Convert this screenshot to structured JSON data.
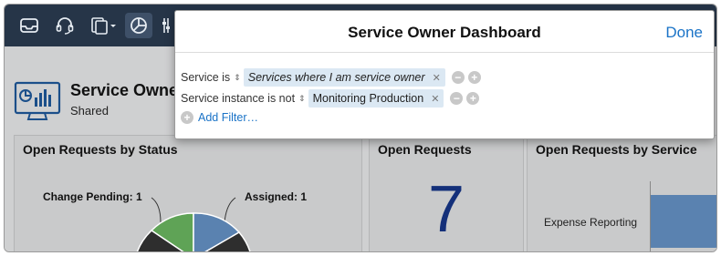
{
  "topbar": {
    "icons": [
      "inbox-icon",
      "headset-icon",
      "documents-icon",
      "dashboard-icon",
      "settings-icon"
    ]
  },
  "dashboard": {
    "title": "Service Owne",
    "subtitle": "Shared",
    "panels": [
      {
        "title": "Open Requests by Status"
      },
      {
        "title": "Open Requests",
        "value": "7"
      },
      {
        "title": "Open Requests by Service"
      }
    ],
    "status_chart": {
      "labels": [
        "Change Pending: 1",
        "Assigned: 1"
      ]
    },
    "service_chart": {
      "label": "Expense Reporting"
    }
  },
  "popover": {
    "title": "Service Owner Dashboard",
    "done_label": "Done",
    "filters": [
      {
        "field": "Service is",
        "value": "Services where I am service owner",
        "italic": true
      },
      {
        "field": "Service instance is not",
        "value": "Monitoring Production",
        "italic": false
      }
    ],
    "add_filter_label": "Add Filter…"
  },
  "colors": {
    "nav_bg": "#263548",
    "link": "#1a73c7",
    "chip_bg": "#dbe8f3",
    "big_number": "#14307a",
    "pie_green": "#5fa356",
    "pie_blue": "#5a82b0",
    "pie_dark": "#2e2e2e"
  }
}
